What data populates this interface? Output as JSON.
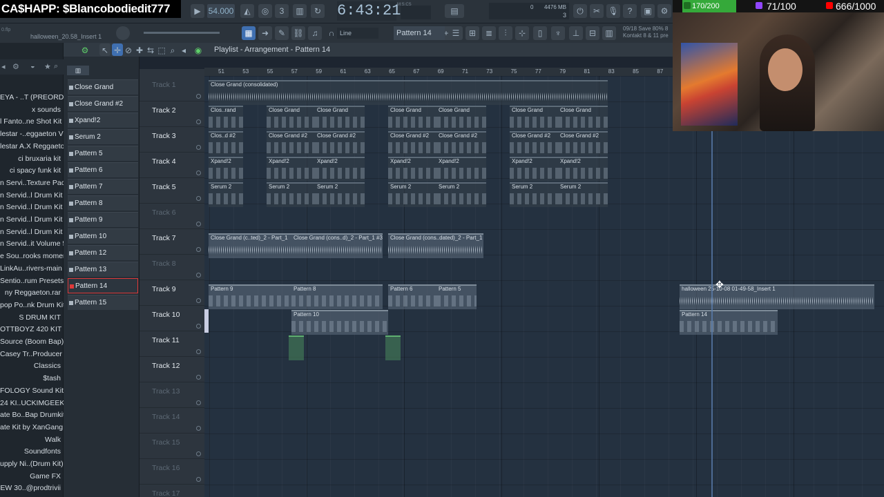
{
  "stream": {
    "cashapp": "CA$HAPP: $Blancobodiedit777",
    "goals": [
      {
        "text": "170/200",
        "color": "#35a93a"
      },
      {
        "text": "71/100",
        "color": "#9146ff"
      },
      {
        "text": "666/1000",
        "color": "#ff0000"
      }
    ]
  },
  "toolbar": {
    "bpm": "54.000",
    "time": "6:43:21",
    "time_unit": "M:S:CS",
    "memory": "4476 MB",
    "cpu_num": "3",
    "mem_zero": "0",
    "snap": "Line",
    "pattern": "Pattern 14",
    "hint_top": "0.flp",
    "hint": "halloween_20.58_Insert 1",
    "kontakt_line1": "09/18 Save 80% 8",
    "kontakt_line2": "Kontakt 8 & 11 pre"
  },
  "playlist": {
    "title": "Playlist - Arrangement - Pattern 14",
    "ruler": [
      "51",
      "53",
      "55",
      "57",
      "59",
      "61",
      "63",
      "65",
      "67",
      "69",
      "71",
      "73",
      "75",
      "77",
      "79",
      "81",
      "83",
      "85",
      "87"
    ]
  },
  "browser": [
    "EYA - ..T (PREORDER)",
    "x sounds",
    "l Fanto..ne Shot Kit",
    "lestar -..eggaeton V2",
    "lestar A.X Reggaeton",
    "ci bruxaria kit",
    "ci spacy funk kit",
    "n Servi..Texture Pack",
    "n Servid..l Drum Kit 1",
    "n Servid..l Drum Kit 4",
    "n Servid..l Drum Kit 5",
    "n Servid..l Drum Kit 6",
    "n Servid..it Volume 5",
    "e Sou..rooks moment",
    "LinkAu..rivers-main",
    "Sentio..rum Presets",
    "ny Reggaeton.rar",
    "pop Po..nk Drum Kit",
    "S DRUM KIT",
    "OTTBOYZ 420 KIT",
    "Source (Boom Bap)",
    "Casey Tr..Producer Kit",
    "Classics",
    "$tash",
    "FOLOGY Sound Kit",
    "24 KI..UCKIMGEEKED",
    "ate Bo..Bap Drumkit",
    "ate Kit by XanGang",
    "Walk",
    "Soundfonts",
    "upply Ni..(Drum Kit)",
    "Game FX",
    "EW 30..@prodtrivii"
  ],
  "patterns": [
    "Close Grand",
    "Close Grand #2",
    "Xpand!2",
    "Serum 2",
    "Pattern 5",
    "Pattern 6",
    "Pattern 7",
    "Pattern 8",
    "Pattern 9",
    "Pattern 10",
    "Pattern 12",
    "Pattern 13",
    "Pattern 14",
    "Pattern 15"
  ],
  "selected_pattern": "Pattern 14",
  "tracks": [
    {
      "name": "Track 1",
      "dim": true
    },
    {
      "name": "Track 2",
      "dim": false
    },
    {
      "name": "Track 3",
      "dim": false
    },
    {
      "name": "Track 4",
      "dim": false
    },
    {
      "name": "Track 5",
      "dim": false
    },
    {
      "name": "Track 6",
      "dim": true
    },
    {
      "name": "Track 7",
      "dim": false
    },
    {
      "name": "Track 8",
      "dim": true
    },
    {
      "name": "Track 9",
      "dim": false
    },
    {
      "name": "Track 10",
      "dim": false
    },
    {
      "name": "Track 11",
      "dim": false
    },
    {
      "name": "Track 12",
      "dim": false
    },
    {
      "name": "Track 13",
      "dim": true
    },
    {
      "name": "Track 14",
      "dim": true
    },
    {
      "name": "Track 15",
      "dim": true
    },
    {
      "name": "Track 16",
      "dim": true
    },
    {
      "name": "Track 17",
      "dim": true
    }
  ],
  "clips": {
    "t1": "Close Grand (consolidated)",
    "t2a": "Clos..rand",
    "t2": "Close Grand",
    "t3a": "Clos..d #2",
    "t3": "Close Grand #2",
    "t4": "Xpand!2",
    "t5": "Serum 2",
    "t7a": "Close Grand (c..ted)_2 - Part_1",
    "t7b": "Close Grand (cons..d)_2 - Part_1 #3",
    "t7c": "Close Grand (cons..dated)_2 - Part_1",
    "t9a": "Pattern 9",
    "t9b": "Pattern 8",
    "t9c": "Pattern 6",
    "t9d": "Pattern 5",
    "t9audio": "halloween 25-10-08 01-49-58_Insert 1",
    "t10a": "Pattern 10",
    "t10b": "Pattern 14"
  }
}
